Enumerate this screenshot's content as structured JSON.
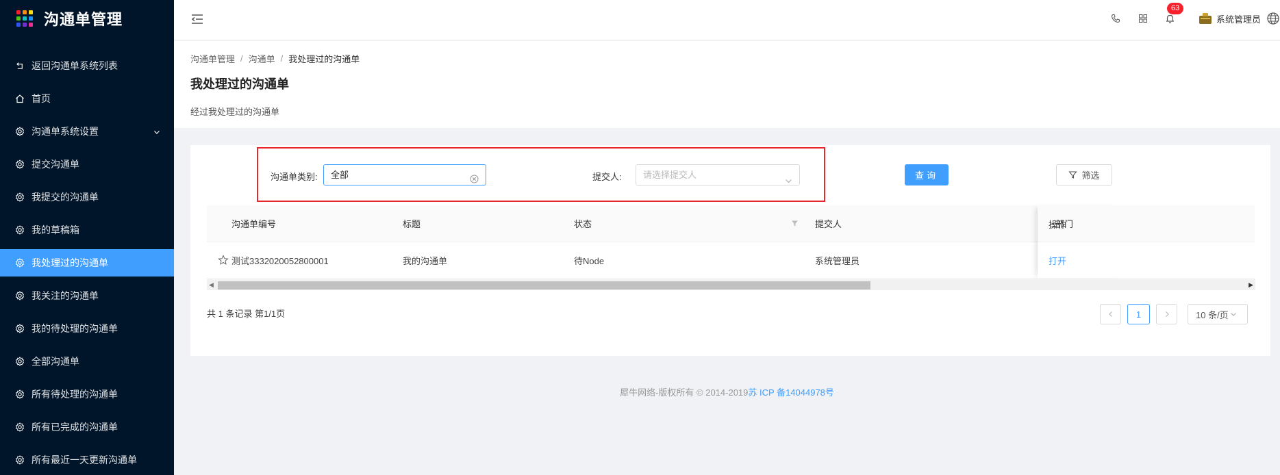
{
  "app": {
    "title": "沟通单管理",
    "logo_colors": [
      "#f5222d",
      "#fa8c16",
      "#fadb14",
      "#52c41a",
      "#13c2c2",
      "#1890ff",
      "#2f54eb",
      "#722ed1",
      "#eb2f96"
    ]
  },
  "sidebar": {
    "items": [
      {
        "label": "返回沟通单系统列表",
        "icon": "return-icon"
      },
      {
        "label": "首页",
        "icon": "home-icon"
      },
      {
        "label": "沟通单系统设置",
        "icon": "gear-icon"
      },
      {
        "label": "提交沟通单",
        "icon": "gear-icon"
      },
      {
        "label": "我提交的沟通单",
        "icon": "gear-icon"
      },
      {
        "label": "我的草稿箱",
        "icon": "gear-icon"
      },
      {
        "label": "我处理过的沟通单",
        "icon": "gear-icon"
      },
      {
        "label": "我关注的沟通单",
        "icon": "gear-icon"
      },
      {
        "label": "我的待处理的沟通单",
        "icon": "gear-icon"
      },
      {
        "label": "全部沟通单",
        "icon": "gear-icon"
      },
      {
        "label": "所有待处理的沟通单",
        "icon": "gear-icon"
      },
      {
        "label": "所有已完成的沟通单",
        "icon": "gear-icon"
      },
      {
        "label": "所有最近一天更新沟通单",
        "icon": "gear-icon"
      }
    ],
    "active_color": "#409eff"
  },
  "header": {
    "notification_count": "63",
    "user_name": "系统管理员"
  },
  "breadcrumb": {
    "items": [
      "沟通单管理",
      "沟通单",
      "我处理过的沟通单"
    ],
    "separator": "/"
  },
  "page": {
    "title": "我处理过的沟通单",
    "description": "经过我处理过的沟通单"
  },
  "filters": {
    "category_label": "沟通单类别:",
    "category_value": "全部",
    "submitter_label": "提交人:",
    "submitter_placeholder": "请选择提交人",
    "query_button": "查询",
    "filter_button": "筛选"
  },
  "table": {
    "columns": [
      "沟通单编号",
      "标题",
      "状态",
      "提交人",
      "部门",
      "操作"
    ],
    "rows": [
      {
        "id": "测试3332020052800001",
        "title": "我的沟通单",
        "status": "待Node",
        "submitter": "系统管理员",
        "department": "",
        "action": "打开"
      }
    ]
  },
  "pagination": {
    "summary": "共 1 条记录 第1/1页",
    "current_page": "1",
    "page_size": "10 条/页"
  },
  "footer": {
    "copyright": "犀牛网络-版权所有 © 2014-2019",
    "icp": "苏 ICP 备14044978号"
  }
}
